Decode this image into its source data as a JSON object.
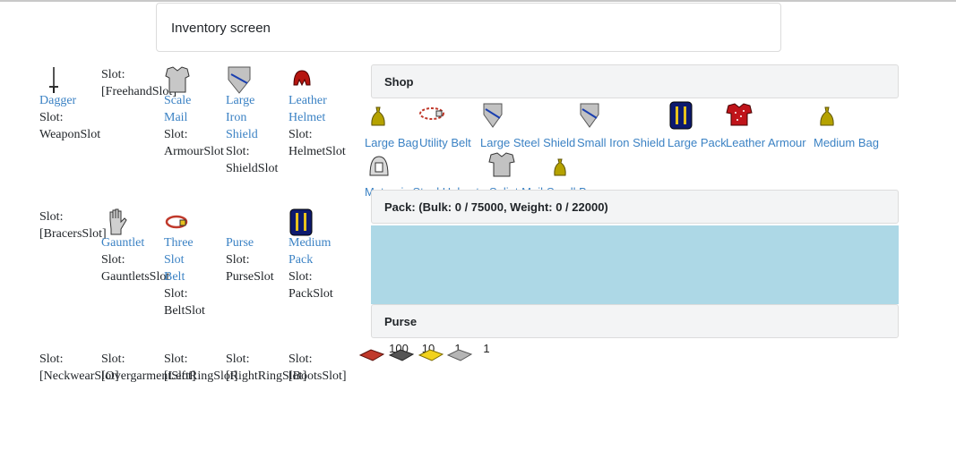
{
  "title": "Inventory screen",
  "slots": {
    "dagger": {
      "name": "Dagger",
      "slot_prefix": "Slot:",
      "slot": "WeaponSlot"
    },
    "freehand": {
      "slot_prefix": "Slot:",
      "slot": "[FreehandSlot]"
    },
    "scale_mail": {
      "name_l1": "Scale",
      "name_l2": "Mail",
      "slot_prefix": "Slot:",
      "slot": "ArmourSlot"
    },
    "large_iron_shield": {
      "name_l1": "Large",
      "name_l2": "Iron",
      "name_l3": "Shield",
      "slot_prefix": "Slot:",
      "slot": "ShieldSlot"
    },
    "leather_helmet": {
      "name_l1": "Leather",
      "name_l2": "Helmet",
      "slot_prefix": "Slot:",
      "slot": "HelmetSlot"
    },
    "bracers": {
      "slot_prefix": "Slot:",
      "slot": "[BracersSlot]"
    },
    "gauntlet": {
      "name": "Gauntlet",
      "slot_prefix": "Slot:",
      "slot": "GauntletsSlot"
    },
    "three_slot_belt": {
      "name_l1": "Three",
      "name_l2": "Slot",
      "name_l3": "Belt",
      "slot_prefix": "Slot:",
      "slot": "BeltSlot"
    },
    "purse": {
      "name": "Purse",
      "slot_prefix": "Slot:",
      "slot": "PurseSlot"
    },
    "medium_pack": {
      "name_l1": "Medium",
      "name_l2": "Pack",
      "slot_prefix": "Slot:",
      "slot": "PackSlot"
    },
    "neckwear": {
      "slot_prefix": "Slot:",
      "slot": "[NeckwearSlot]"
    },
    "overgarment": {
      "slot_prefix": "Slot:",
      "slot": "[OvergarmentSlot]"
    },
    "left_ring": {
      "slot_prefix": "Slot:",
      "slot": "[LeftRingSlot]"
    },
    "right_ring": {
      "slot_prefix": "Slot:",
      "slot": "[RightRingSlot]"
    },
    "boots": {
      "slot_prefix": "Slot:",
      "slot": "[BootsSlot]"
    }
  },
  "shop": {
    "header": "Shop",
    "items": [
      {
        "label": "Large Bag",
        "icon": "bag-icon"
      },
      {
        "label": "Utility Belt",
        "icon": "belt-icon"
      },
      {
        "label": "Large Steel Shield",
        "icon": "shield-icon"
      },
      {
        "label": "Small Iron Shield",
        "icon": "shield-icon"
      },
      {
        "label": "Large Pack",
        "icon": "pack-icon"
      },
      {
        "label": "Leather Armour",
        "icon": "armour-icon"
      },
      {
        "label": "Medium Bag",
        "icon": "bag-icon"
      },
      {
        "label": "Meteoric Steel Helmet",
        "icon": "helmet-icon"
      },
      {
        "label": "Splint Mail",
        "icon": "mail-icon"
      },
      {
        "label": "Small Bag",
        "icon": "bag-icon"
      }
    ]
  },
  "pack": {
    "header": "Pack: (Bulk: 0 / 75000, Weight: 0 / 22000)"
  },
  "purse": {
    "header": "Purse",
    "coins": [
      {
        "count": "100",
        "color": "#c0392b"
      },
      {
        "count": "10",
        "color": "#555555"
      },
      {
        "count": "1",
        "color": "#f2d21b"
      },
      {
        "count": "1",
        "color": "#b5b5b5"
      }
    ]
  },
  "colors": {
    "link": "#3b82c4",
    "pack_bg": "#add8e6",
    "header_bg": "#f3f4f5"
  }
}
